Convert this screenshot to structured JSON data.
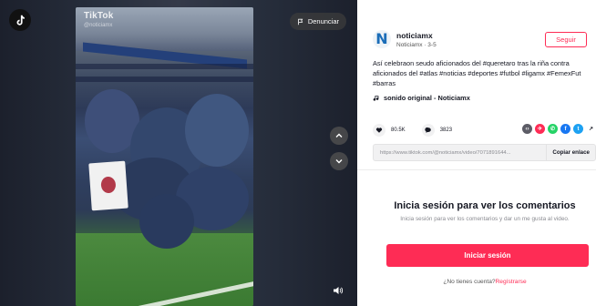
{
  "video": {
    "watermark": "TikTok",
    "watermark_handle": "@noticiamx",
    "report_label": "Denunciar",
    "icons": {
      "logo": "tiktok-logo-icon",
      "report": "flag-icon",
      "up": "chevron-up-icon",
      "down": "chevron-down-icon",
      "volume": "volume-icon"
    }
  },
  "author": {
    "avatar_letter": "N",
    "username": "noticiamx",
    "meta": "Noticiamx · 3-5",
    "follow_label": "Seguir"
  },
  "description": "Así celebraon seudo aficionados del #queretaro tras la riña contra aficionados del #atlas #noticias #deportes #futbol #ligamx #FemexFut #barras",
  "sound": "sonido original - Noticiamx",
  "stats": {
    "likes": "80.5K",
    "comments": "3823"
  },
  "share_icons": [
    "embed-icon",
    "pinterest-icon",
    "whatsapp-icon",
    "facebook-icon",
    "twitter-icon",
    "share-arrow-icon"
  ],
  "colors": {
    "accent": "#fe2c55",
    "text": "#161823",
    "muted": "#8a8b91"
  },
  "link": {
    "url": "https://www.tiktok.com/@noticiamx/video/7071891644...",
    "copy_label": "Copiar enlace"
  },
  "login": {
    "title": "Inicia sesión para ver los comentarios",
    "subtitle": "Inicia sesión para ver los comentarios y dar un me gusta al video.",
    "button_label": "Iniciar sesión",
    "signup_prefix": "¿No tienes cuenta?",
    "signup_link": "Regístrarse"
  }
}
